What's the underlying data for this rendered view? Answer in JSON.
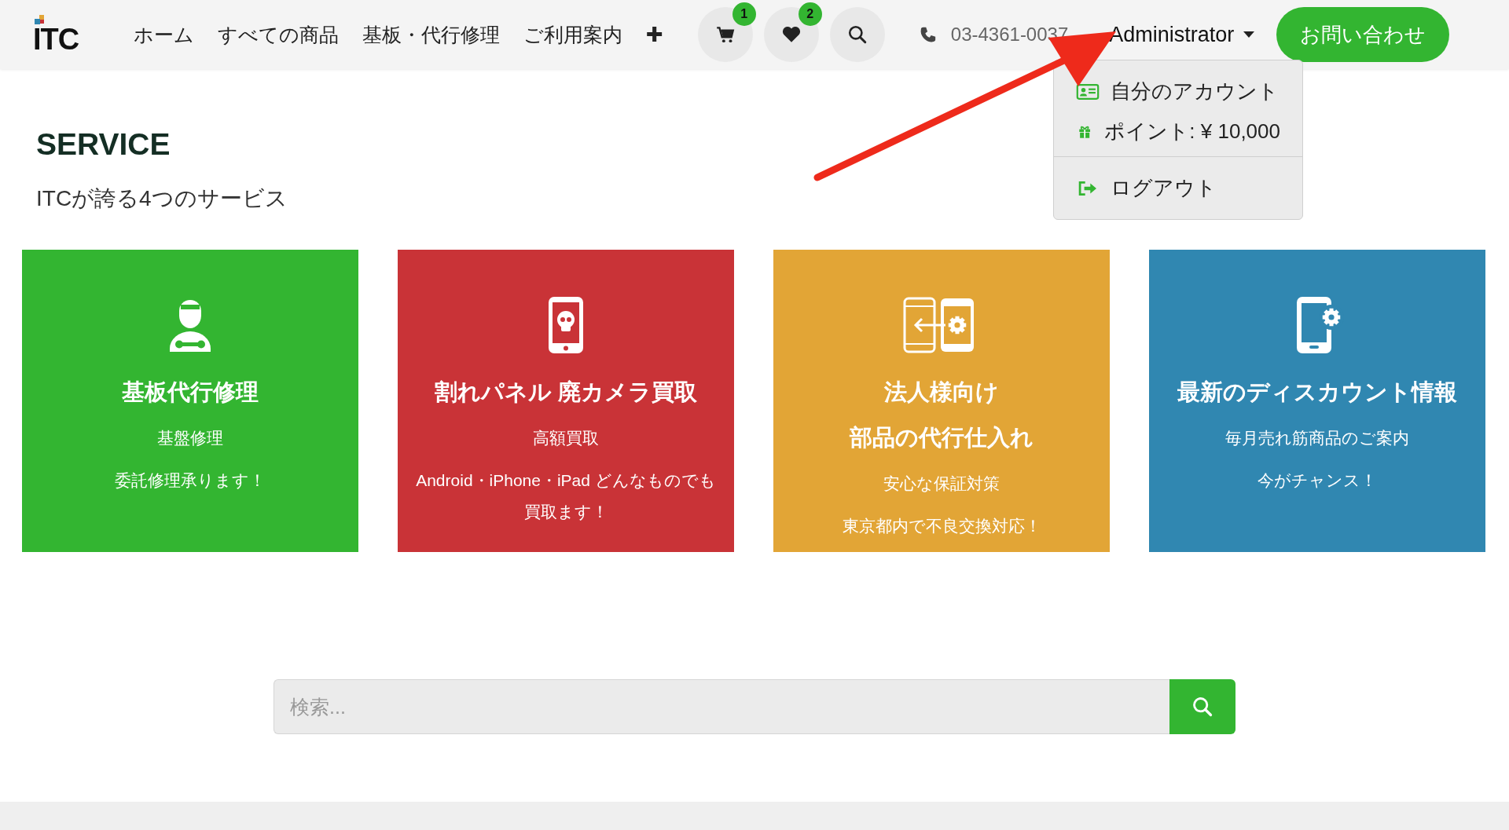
{
  "header": {
    "logo": "ITC",
    "nav": [
      "ホーム",
      "すべての商品",
      "基板・代行修理",
      "ご利用案内",
      "✚"
    ],
    "icon_buttons": [
      {
        "kind": "cart",
        "badge": "1"
      },
      {
        "kind": "heart",
        "badge": "2"
      },
      {
        "kind": "search"
      }
    ],
    "phone": "03-4361-0037",
    "user": "Administrator",
    "contact_button": "お問い合わせ"
  },
  "user_menu": {
    "groups": [
      [
        {
          "kind": "account",
          "label": "自分のアカウント"
        },
        {
          "kind": "points",
          "label": "ポイント: ¥ 10,000"
        }
      ],
      [
        {
          "kind": "logout",
          "label": "ログアウト"
        }
      ]
    ]
  },
  "service": {
    "heading": "SERVICE",
    "subtitle": "ITCが誇る4つのサービス"
  },
  "cards": [
    {
      "kind": "mechanic",
      "color": "#33b531",
      "title": [
        "基板代行修理"
      ],
      "lines": [
        "基盤修理",
        "委託修理承ります！"
      ]
    },
    {
      "kind": "broken-phone",
      "color": "#c93337",
      "title": [
        "割れパネル 廃カメラ買取"
      ],
      "lines": [
        "高額買取",
        "Android・iPhone・iPad どんなものでも買取ます！"
      ]
    },
    {
      "kind": "transfer",
      "color": "#e2a536",
      "title": [
        "法人様向け",
        "部品の代行仕入れ"
      ],
      "lines": [
        "安心な保証対策",
        "東京都内で不良交換対応！"
      ]
    },
    {
      "kind": "phone-gear",
      "color": "#3087b1",
      "title": [
        "最新のディスカウント情報"
      ],
      "lines": [
        "毎月売れ筋商品のご案内",
        "今がチャンス！"
      ]
    }
  ],
  "search": {
    "placeholder": "検索..."
  }
}
